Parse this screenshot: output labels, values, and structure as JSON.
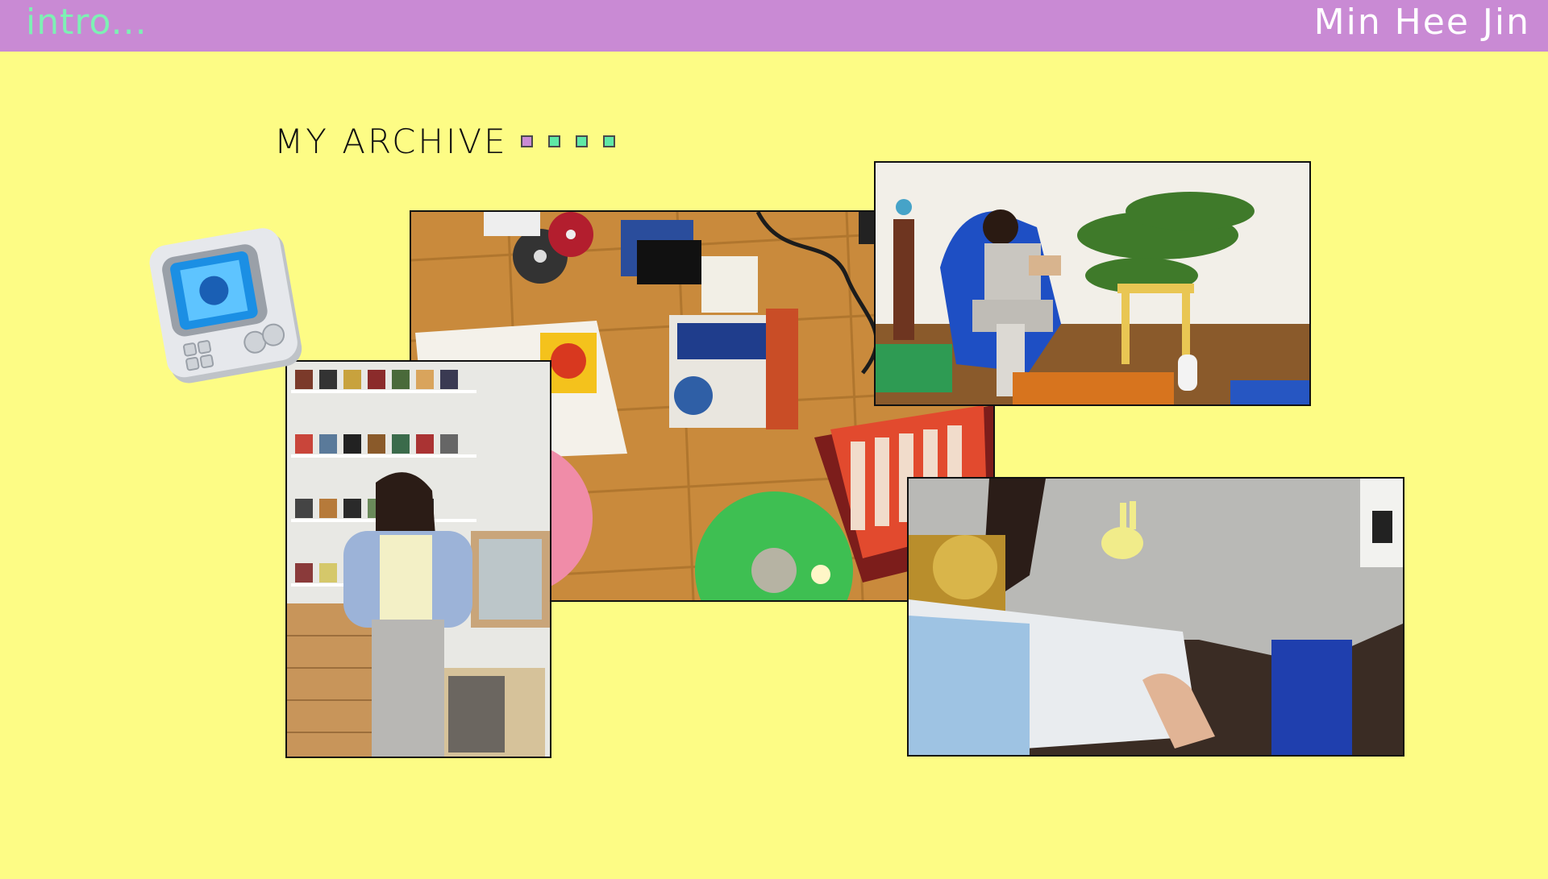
{
  "header": {
    "intro_label": "intro...",
    "author_name": "Min Hee Jin"
  },
  "section": {
    "title": "MY ARCHIVE"
  },
  "pager": {
    "dots": [
      "page-1",
      "page-2",
      "page-3",
      "page-4"
    ],
    "active_index": 0
  },
  "colors": {
    "background": "#fdfc85",
    "header_bar": "#c98ad4",
    "intro_text": "#7ef0b4",
    "author_text": "#ffffff",
    "dot_active": "#c98ad4",
    "dot_inactive": "#5fe8a6"
  },
  "photos": [
    {
      "name": "vinyl-records-floor-photo"
    },
    {
      "name": "woman-in-blue-chair-photo"
    },
    {
      "name": "woman-by-cd-shelf-photo"
    },
    {
      "name": "reading-magazine-photo"
    }
  ],
  "icons": {
    "device": "retro-device-icon"
  }
}
